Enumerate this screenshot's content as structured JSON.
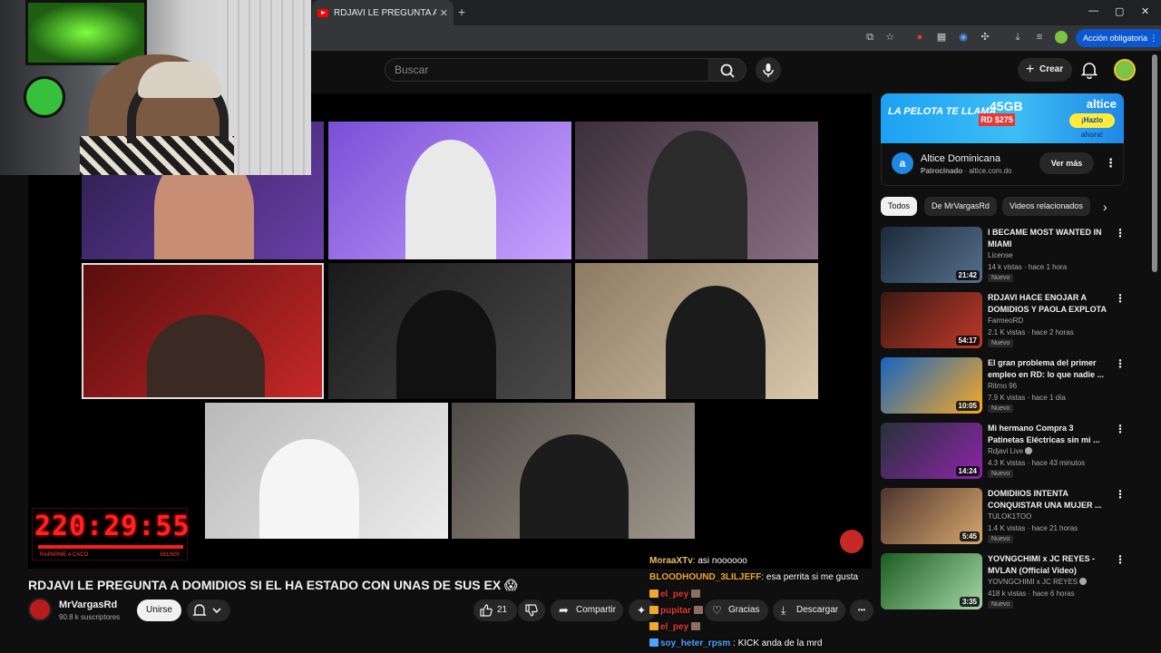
{
  "browser": {
    "tab_title": "RDJAVI LE PREGUNTA A DOMIDIOS SI EL HA ESTADO CON UNAS DE SUS EX",
    "new_tab": "+",
    "tab_close": "✕",
    "action_button": "Acción obligatoria",
    "window_controls": [
      "—",
      "▢",
      "✕"
    ]
  },
  "header": {
    "search_placeholder": "Buscar",
    "create_label": "Crear"
  },
  "player": {
    "timer_digits": "220:29:55",
    "timer_caption": "RAPARME A CACO",
    "timer_count": "581/500"
  },
  "video": {
    "title": "RDJAVI LE PREGUNTA A DOMIDIOS SI EL HA ESTADO CON UNAS DE SUS EX 😱",
    "channel_name": "MrVargasRd",
    "subscribers": "90.8 k suscriptores",
    "join_label": "Unirse",
    "like_count": "21",
    "share_label": "Compartir",
    "thanks_label": "Gracias",
    "download_label": "Descargar",
    "more_label": "•••"
  },
  "chat": [
    {
      "user": "MoraaXTv",
      "text": ": asi noooooo",
      "color": "#e8c25a"
    },
    {
      "user": "BLOODHOUND_3LILJEFF",
      "text": ": esa perrita si me gusta",
      "color": "#f0a830"
    },
    {
      "user": "el_pey",
      "text": "",
      "color": "#e53935"
    },
    {
      "user": "pupitar",
      "text": "",
      "color": "#e53935"
    },
    {
      "user": "el_pey",
      "text": "",
      "color": "#e53935"
    },
    {
      "user": "soy_heter_rpsm",
      "text": ": KICK anda de la mrd",
      "color": "#4ea3ff"
    }
  ],
  "ad": {
    "slogan": "LA PELOTA TE LLAMA",
    "gb": "45GB",
    "price": "RD $275",
    "brand": "altice",
    "cta": "¡Hazlo ahora!",
    "advertiser": "Altice Dominicana",
    "sponsored_label": "Patrocinado",
    "domain": "altice.com.do",
    "more_label": "Ver más"
  },
  "chips": [
    "Todos",
    "De MrVargasRd",
    "Videos relacionados"
  ],
  "recommendations": [
    {
      "title": "I BECAME MOST WANTED IN MIAMI",
      "channel": "License",
      "views": "14 k vistas",
      "age": "hace 1 hora",
      "duration": "21:42",
      "badge": "Nuevo",
      "thumb_colors": [
        "#1b2a3a",
        "#56708c"
      ]
    },
    {
      "title": "RDJAVI HACE ENOJAR A DOMIDIOS Y PAOLA EXPLOTA ...",
      "channel": "FarmeoRD",
      "views": "2.1 K vistas",
      "age": "hace 2 horas",
      "duration": "54:17",
      "badge": "Nuevo",
      "thumb_colors": [
        "#3b1a12",
        "#c0392b"
      ]
    },
    {
      "title": "El gran problema del primer empleo en RD: lo que nadie ...",
      "channel": "Ritmo 96",
      "views": "7.9 K vistas",
      "age": "hace 1 día",
      "duration": "10:05",
      "badge": "Nuevo",
      "thumb_colors": [
        "#1565c0",
        "#f9a825"
      ]
    },
    {
      "title": "Mi hermano Compra 3 Patinetas Eléctricas sin mi ...",
      "channel": "Rdjavi Live",
      "views": "4.3 K vistas",
      "age": "hace 43 minutos",
      "duration": "14:24",
      "badge": "Nuevo",
      "thumb_colors": [
        "#263238",
        "#8e24aa"
      ]
    },
    {
      "title": "DOMIDIIOS INTENTA CONQUISTAR UNA MUJER ...",
      "channel": "TULOK1TOO",
      "views": "1.4 K vistas",
      "age": "hace 21 horas",
      "duration": "5:45",
      "badge": "Nuevo",
      "thumb_colors": [
        "#4e342e",
        "#d7a86e"
      ]
    },
    {
      "title": "YOVNGCHIMI x JC REYES - MVLAN (Official Video)",
      "channel": "YOVNGCHIMI x JC REYES",
      "views": "418 k vistas",
      "age": "hace 6 horas",
      "duration": "3:35",
      "badge": "Nuevo",
      "thumb_colors": [
        "#1b5e20",
        "#a5d6a7"
      ]
    }
  ]
}
